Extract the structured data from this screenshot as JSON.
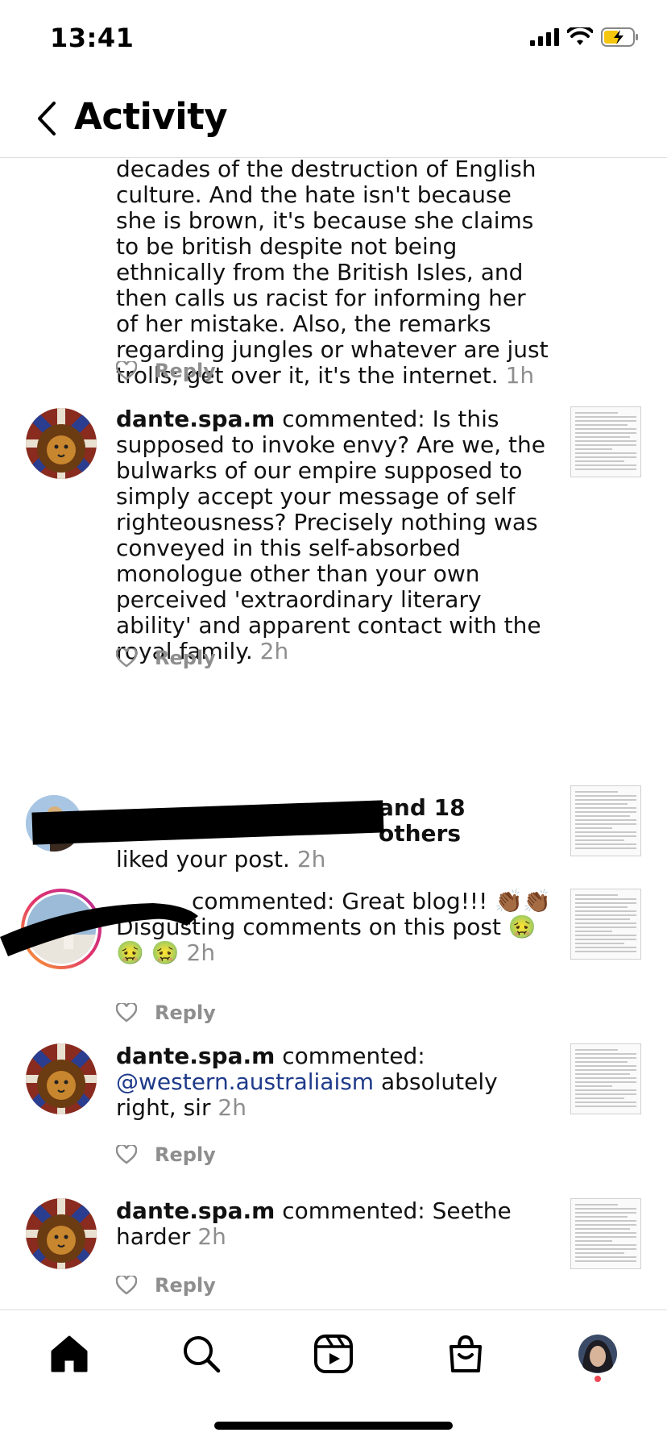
{
  "status_bar": {
    "time": "13:41"
  },
  "header": {
    "title": "Activity"
  },
  "actions": {
    "reply_label": "Reply"
  },
  "feed": {
    "partial_comment": {
      "text": "decades of the destruction of English culture. And the hate isn't because she is brown, it's because she claims to be british despite not being ethnically from the British Isles, and then calls us racist for informing her of her mistake. Also, the remarks regarding jungles or whatever are just trolls; get over it, it's the internet.",
      "time": "1h"
    },
    "comment_1": {
      "user": "dante.spa.m",
      "verb": "commented:",
      "text": "Is this supposed to invoke envy? Are we, the bulwarks of our empire supposed to simply accept your message of self righteousness? Precisely nothing was conveyed in this self-absorbed monologue other than your own perceived 'extraordinary literary ability' and apparent contact with the royal family.",
      "time": "2h"
    },
    "likes": {
      "others": "and 18 others",
      "text": "liked your post.",
      "time": "2h"
    },
    "comment_2": {
      "verb": "commented:",
      "text": "Great blog!!! 👏🏾👏🏾 Disgusting comments on this post 🤢🤢 🤢",
      "time": "2h"
    },
    "comment_3": {
      "user": "dante.spa.m",
      "verb": "commented:",
      "mention": "@western.australiaism",
      "text": "absolutely right, sir",
      "time": "2h"
    },
    "comment_4": {
      "user": "dante.spa.m",
      "verb": "commented:",
      "text": "Seethe harder",
      "time": "2h"
    }
  },
  "tabbar": {
    "tabs": [
      "home-icon",
      "search-icon",
      "reels-icon",
      "shop-icon",
      "profile-avatar"
    ]
  }
}
